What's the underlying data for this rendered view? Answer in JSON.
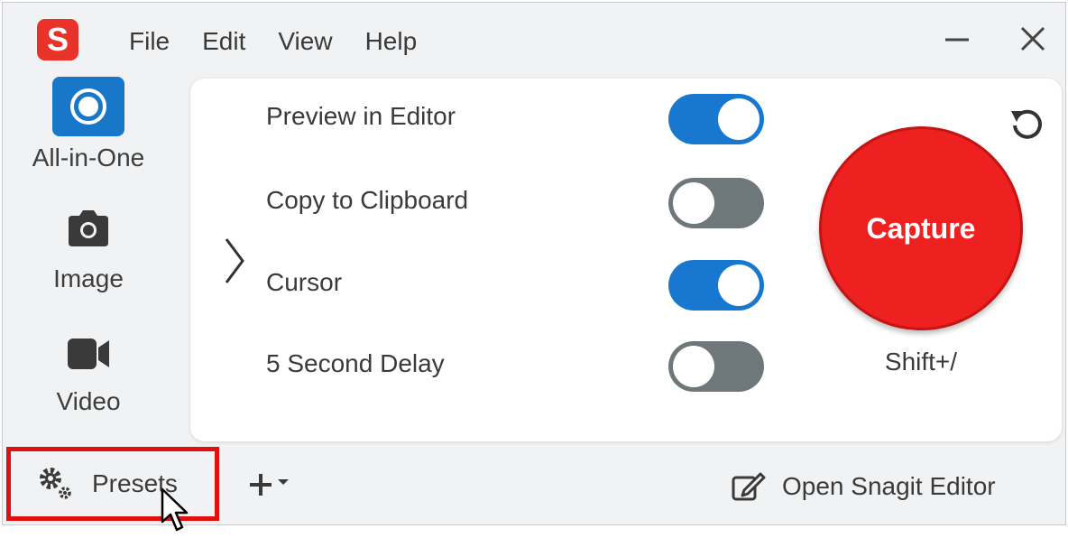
{
  "app": {
    "logo_letter": "S"
  },
  "menu": [
    "File",
    "Edit",
    "View",
    "Help"
  ],
  "modes": [
    {
      "label": "All-in-One",
      "icon": "all-in-one-icon",
      "selected": true
    },
    {
      "label": "Image",
      "icon": "camera-icon",
      "selected": false
    },
    {
      "label": "Video",
      "icon": "video-camera-icon",
      "selected": false
    }
  ],
  "options": [
    {
      "label": "Preview in Editor",
      "on": true
    },
    {
      "label": "Copy to Clipboard",
      "on": false
    },
    {
      "label": "Cursor",
      "on": true
    },
    {
      "label": "5 Second Delay",
      "on": false
    }
  ],
  "capture": {
    "label": "Capture",
    "shortcut": "Shift+/"
  },
  "bottom": {
    "presets_label": "Presets",
    "open_editor_label": "Open Snagit Editor"
  },
  "colors": {
    "accent": "#1878d0",
    "capture": "#ee2020",
    "highlight": "#e01010",
    "logo": "#e8322a"
  }
}
